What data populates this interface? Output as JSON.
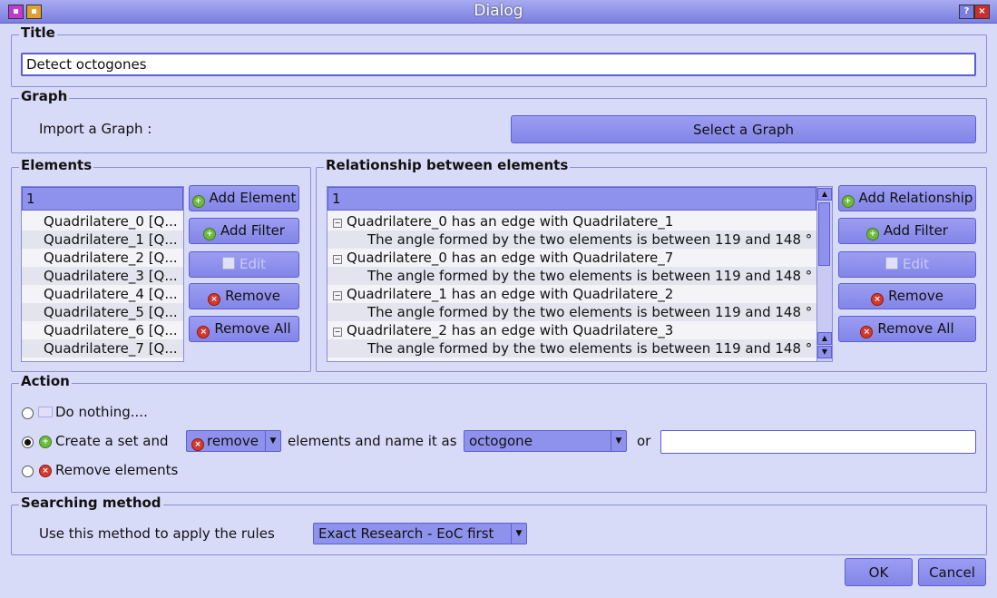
{
  "window": {
    "title": "Dialog"
  },
  "title_section": {
    "legend": "Title",
    "value": "Detect octogones"
  },
  "graph_section": {
    "legend": "Graph",
    "import_label": "Import a Graph :",
    "select_button": "Select a Graph"
  },
  "elements_section": {
    "legend": "Elements",
    "list_header": "1",
    "items": [
      "Quadrilatere_0 [Q...",
      "Quadrilatere_1 [Q...",
      "Quadrilatere_2 [Q...",
      "Quadrilatere_3 [Q...",
      "Quadrilatere_4 [Q...",
      "Quadrilatere_5 [Q...",
      "Quadrilatere_6 [Q...",
      "Quadrilatere_7 [Q..."
    ],
    "buttons": {
      "add_element": "Add Element",
      "add_filter": "Add Filter",
      "edit": "Edit",
      "remove": "Remove",
      "remove_all": "Remove All"
    }
  },
  "relationship_section": {
    "legend": "Relationship between elements",
    "list_header": "1",
    "rows": [
      "Quadrilatere_0 has an edge with Quadrilatere_1",
      "The angle formed by the two elements  is between 119 and 148 °",
      "Quadrilatere_0 has an edge with Quadrilatere_7",
      "The angle formed by the two elements  is between 119 and 148 °",
      "Quadrilatere_1 has an edge with Quadrilatere_2",
      "The angle formed by the two elements  is between 119 and 148 °",
      "Quadrilatere_2 has an edge with Quadrilatere_3",
      "The angle formed by the two elements  is between 119 and 148 °"
    ],
    "buttons": {
      "add_relationship": "Add Relationship",
      "add_filter": "Add Filter",
      "edit": "Edit",
      "remove": "Remove",
      "remove_all": "Remove All"
    }
  },
  "action_section": {
    "legend": "Action",
    "do_nothing": "Do nothing....",
    "create_set": "Create a set and",
    "mode_value": "remove",
    "name_text": "elements and name it as",
    "name_value": "octogone",
    "or_text": "or",
    "custom_name": "",
    "remove_elements": "Remove elements",
    "selected": "create_set"
  },
  "search_section": {
    "legend": "Searching method",
    "label": "Use this method to apply the rules",
    "method": "Exact Research - EoC first"
  },
  "footer": {
    "ok": "OK",
    "cancel": "Cancel"
  }
}
